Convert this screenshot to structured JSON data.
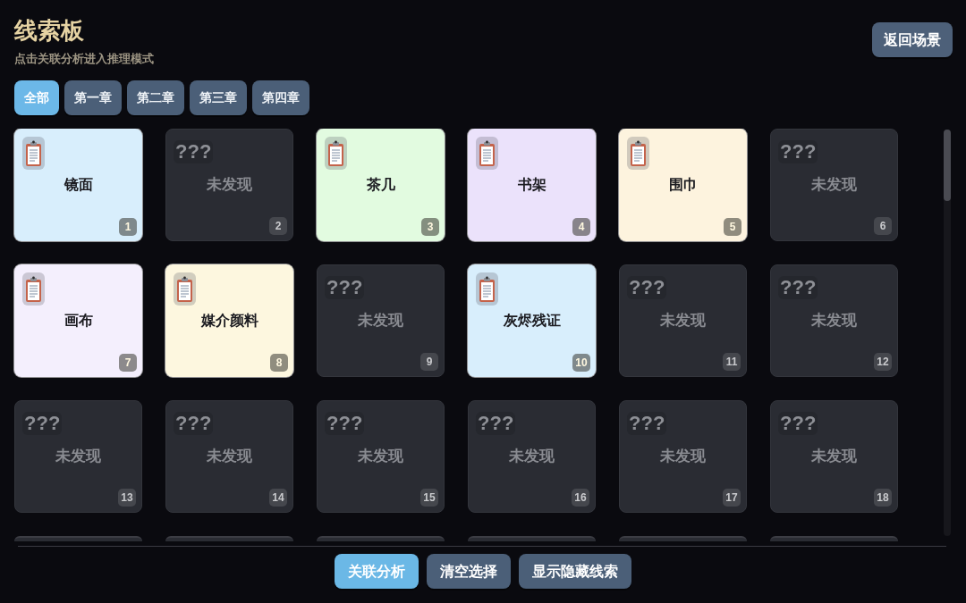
{
  "header": {
    "title": "线索板",
    "subtitle": "点击关联分析进入推理模式",
    "back_button": "返回场景"
  },
  "tabs": [
    {
      "label": "全部",
      "selected": true
    },
    {
      "label": "第一章",
      "selected": false
    },
    {
      "label": "第二章",
      "selected": false
    },
    {
      "label": "第三章",
      "selected": false
    },
    {
      "label": "第四章",
      "selected": false
    }
  ],
  "clue_cards": [
    {
      "kind": "discovered",
      "name": "镜面",
      "number": "1",
      "color": "#d8eefc"
    },
    {
      "kind": "undiscovered",
      "mystery": "???",
      "name": "未发现",
      "number": "2"
    },
    {
      "kind": "discovered",
      "name": "茶几",
      "number": "3",
      "color": "#e2fbe0"
    },
    {
      "kind": "discovered",
      "name": "书架",
      "number": "4",
      "color": "#ebe2fb"
    },
    {
      "kind": "discovered",
      "name": "围巾",
      "number": "5",
      "color": "#fdf3de"
    },
    {
      "kind": "undiscovered",
      "mystery": "???",
      "name": "未发现",
      "number": "6"
    },
    {
      "kind": "discovered",
      "name": "画布",
      "number": "7",
      "color": "#f4effd"
    },
    {
      "kind": "discovered",
      "name": "媒介颜料",
      "number": "8",
      "color": "#fdf7df"
    },
    {
      "kind": "undiscovered",
      "mystery": "???",
      "name": "未发现",
      "number": "9"
    },
    {
      "kind": "discovered",
      "name": "灰烬残证",
      "number": "10",
      "color": "#d8eefc"
    },
    {
      "kind": "undiscovered",
      "mystery": "???",
      "name": "未发现",
      "number": "11"
    },
    {
      "kind": "undiscovered",
      "mystery": "???",
      "name": "未发现",
      "number": "12"
    },
    {
      "kind": "undiscovered",
      "mystery": "???",
      "name": "未发现",
      "number": "13"
    },
    {
      "kind": "undiscovered",
      "mystery": "???",
      "name": "未发现",
      "number": "14"
    },
    {
      "kind": "undiscovered",
      "mystery": "???",
      "name": "未发现",
      "number": "15"
    },
    {
      "kind": "undiscovered",
      "mystery": "???",
      "name": "未发现",
      "number": "16"
    },
    {
      "kind": "undiscovered",
      "mystery": "???",
      "name": "未发现",
      "number": "17"
    },
    {
      "kind": "undiscovered",
      "mystery": "???",
      "name": "未发现",
      "number": "18"
    }
  ],
  "actions": [
    {
      "label": "关联分析",
      "primary": true
    },
    {
      "label": "清空选择",
      "primary": false
    },
    {
      "label": "显示隐藏线索",
      "primary": false
    }
  ]
}
